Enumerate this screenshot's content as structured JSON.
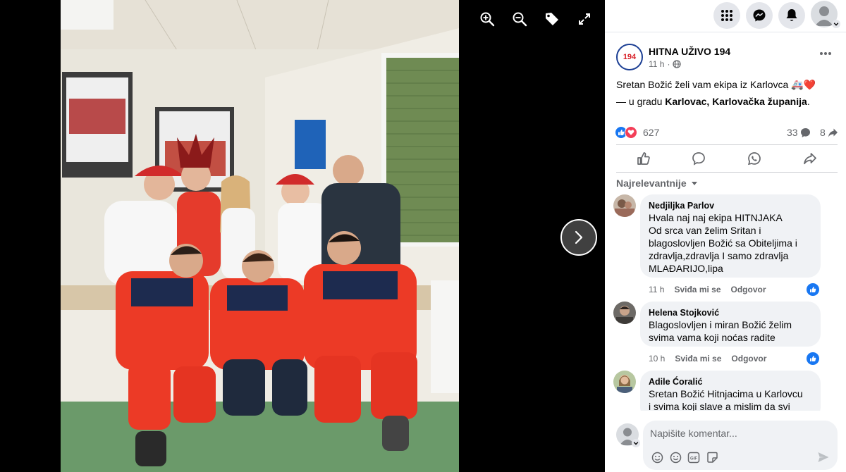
{
  "page": {
    "name": "HITNA UŽIVO 194",
    "avatar_label": "194",
    "time": "11 h",
    "separator": "·",
    "privacy_icon": "globe-icon"
  },
  "post": {
    "text_line1": "Sretan Božić želi vam ekipa iz Karlovca 🚑❤️",
    "location_prefix": "— u gradu ",
    "location": "Karlovac, Karlovačka županija",
    "location_suffix": "."
  },
  "stats": {
    "reactions": "627",
    "comments": "33",
    "shares": "8"
  },
  "actions": [
    "like-icon",
    "comment-icon",
    "whatsapp-icon",
    "share-icon"
  ],
  "sort": {
    "label": "Najrelevantnije"
  },
  "comments": [
    {
      "author": "Nedjiljka Parlov",
      "lines": [
        "Hvala naj naj ekipa HITNJAKA",
        "Od srca van želim Sritan i",
        "blagoslovljen Božić sa Obiteljima i",
        "zdravlja,zdravlja I samo zdravlja",
        "MLAĐARIJO,lipa"
      ],
      "time": "11 h",
      "like_label": "Sviđa mi se",
      "reply_label": "Odgovor"
    },
    {
      "author": "Helena Stojković",
      "lines": [
        "Blagoslovljen i miran Božić želim",
        "svima vama koji noćas radite"
      ],
      "time": "10 h",
      "like_label": "Sviđa mi se",
      "reply_label": "Odgovor"
    },
    {
      "author": "Adile Ćoralić",
      "lines": [
        "Sretan Božić Hitnjacima u Karlovcu",
        "i svima koji slave a mislim da svi"
      ]
    }
  ],
  "composer": {
    "placeholder": "Napišite komentar..."
  },
  "colors": {
    "accent": "#1877f2",
    "love": "#f33e58",
    "text": "#050505",
    "secondary": "#65676b",
    "bubble": "#f0f2f5"
  }
}
